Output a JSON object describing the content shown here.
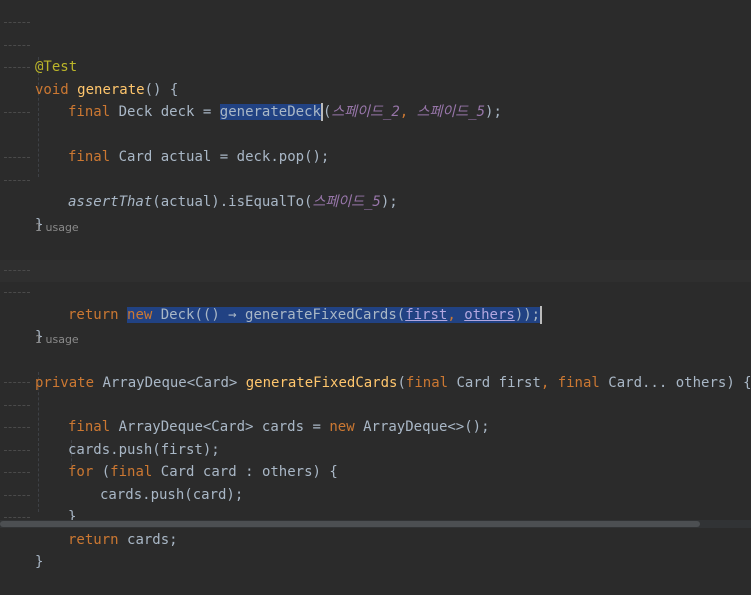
{
  "annotations": {
    "test": "@Test"
  },
  "words": {
    "void": "void",
    "generate": "generate",
    "paren_open_brace": "() {",
    "final": "final",
    "deck_type": "Deck",
    "deck_var": "deck",
    "eq": "=",
    "generateDeck": "generateDeck",
    "arg_spade2": "스페이드_2",
    "comma": ",",
    "arg_spade5": "스페이드_5",
    "close_semi": ");",
    "card_type": "Card",
    "actual": "actual",
    "pop": "deck.pop();",
    "assertThat": "assertThat",
    "assert_rest": "(actual).isEqualTo(",
    "brace_close": "}",
    "usage": "1 usage",
    "private": "private",
    "first": "first",
    "card_ellipsis": "Card",
    "ellipsis": "...",
    "others": "others",
    "close_paren_brace": ") {",
    "return": "return",
    "new": "new",
    "deck_lambda": "Deck(() → ",
    "generateFixedCards": "generateFixedCards",
    "open_paren": "(",
    "close_close_semi": "));",
    "arraydeque_card": "ArrayDeque<Card>",
    "cards": "cards",
    "new_arraydeque": "ArrayDeque<>();",
    "cards_push_first": "cards.push(first);",
    "for": "for",
    "card_var": "card",
    "colon": ":",
    "others_brace": "others) {",
    "cards_push_card": "cards.push(card);",
    "return_cards": "cards;"
  }
}
